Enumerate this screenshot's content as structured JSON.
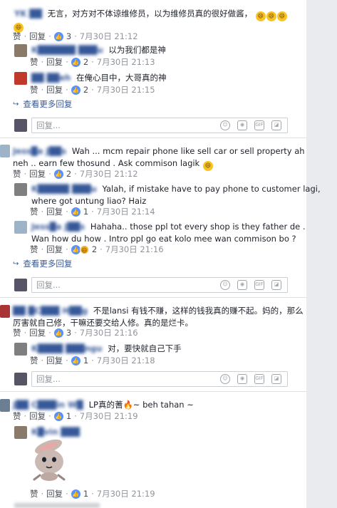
{
  "actions": {
    "like": "赞",
    "reply": "回复",
    "dot": "·",
    "input_placeholder": "回复...",
    "see_more": "查看更多回复"
  },
  "thread1": {
    "comment": {
      "name": "YK ██",
      "text": "无言，对方对不体谅维修员，以为维修员真的很好做酱，",
      "likes": "3",
      "time": "7月30日 21:12"
    },
    "replies": [
      {
        "name": "K██████ ███u",
        "text": "以为我们都是神",
        "likes": "2",
        "time": "7月30日 21:13"
      },
      {
        "name": "██ ██eh",
        "text": "在俺心目中，大哥真的神",
        "likes": "2",
        "time": "7月30日 21:15"
      }
    ]
  },
  "thread2": {
    "comment": {
      "name": "Jess█a J██s",
      "text_line1": "Wah ... mcm repair phone like sell car or sell property ah",
      "text_line2": "neh .. earn few thosund . Ask commison lagik",
      "likes": "2",
      "time": "7月30日 21:12"
    },
    "replies": [
      {
        "name": "K█████ ███u",
        "text_line1": "Yalah, if mistake have to pay phone to customer lagi,",
        "text_line2": "where got untung liao? Haiz",
        "likes": "1",
        "time": "7月30日 21:14"
      },
      {
        "name": "Jess█a J██s",
        "text_line1": "Hahaha.. those ppl tot every shop is they father de .",
        "text_line2": "Wan how du how . Intro ppl go eat kolo mee wan commison bo ?",
        "likes": "2",
        "time": "7月30日 21:16"
      }
    ]
  },
  "thread3": {
    "comment": {
      "name": "██ █C███ H██g",
      "text_line1": "不是lansi 有钱不赚，这样的钱我真的赚不起。妈的，那么",
      "text_line2": "厉害就自己修，干嘛还要交给人修。真的是烂卡。",
      "likes": "3",
      "time": "7月30日 21:16"
    },
    "replies": [
      {
        "name": "K████ ███ngu",
        "text": "对，要快就自己下手",
        "likes": "1",
        "time": "7月30日 21:18"
      }
    ]
  },
  "thread4": {
    "comment": {
      "name": "J██ C███in W█ ",
      "text": "LP真的蓍",
      "text_after": "~ beh tahan ~",
      "likes": "1",
      "time": "7月30日 21:19"
    },
    "replies": [
      {
        "name": "K█vin ███",
        "likes": "1",
        "time": "7月30日 21:19"
      }
    ]
  },
  "colors": {
    "link": "#365899",
    "meta": "#90949c",
    "like": "#5890ff",
    "border": "#dddfe2",
    "sidebar": "#e9ebee"
  }
}
